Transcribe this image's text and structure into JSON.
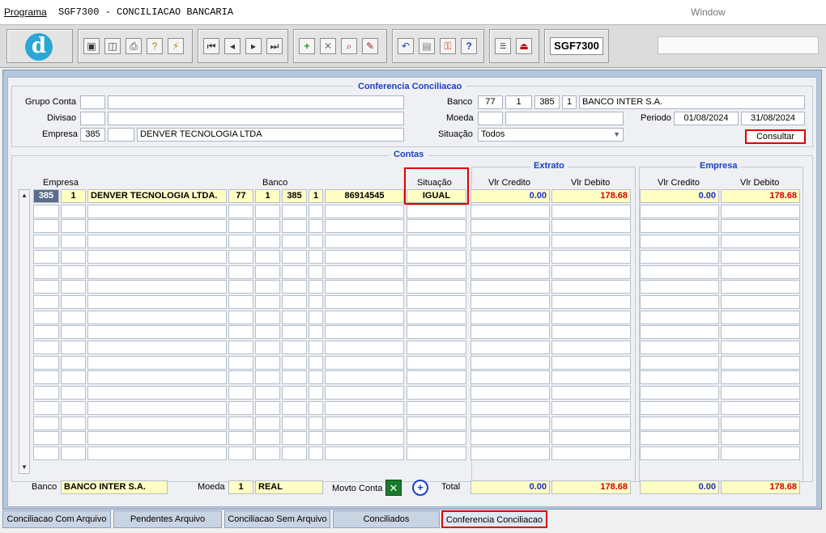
{
  "menubar": {
    "program": "Programa",
    "title": "SGF7300 - CONCILIACAO BANCARIA",
    "window": "Window"
  },
  "toolbar": {
    "code": "SGF7300",
    "icons": [
      "save-icon",
      "print-preview-icon",
      "printer-icon",
      "query-icon",
      "query-execute-icon",
      "first-record-icon",
      "previous-record-icon",
      "next-record-icon",
      "last-record-icon",
      "insert-record-icon",
      "delete-record-icon",
      "find-icon",
      "clear-icon",
      "undo-icon",
      "clipboard-icon",
      "key-help-icon",
      "help-icon",
      "menu-icon",
      "exit-icon"
    ]
  },
  "header": {
    "section_title": "Conferencia Conciliacao",
    "grupo_conta_label": "Grupo Conta",
    "grupo_conta_code": "",
    "grupo_conta_desc": "",
    "divisao_label": "Divisao",
    "divisao_code": "",
    "divisao_desc": "",
    "empresa_label": "Empresa",
    "empresa_code": "385",
    "empresa_sub": "",
    "empresa_desc": "DENVER TECNOLOGIA LTDA",
    "banco_label": "Banco",
    "banco_code": "77",
    "banco_agencia": "1",
    "banco_conta": "385",
    "banco_dig": "1",
    "banco_name": "BANCO INTER S.A.",
    "moeda_label": "Moeda",
    "moeda_code": "",
    "moeda_desc": "",
    "periodo_label": "Periodo",
    "periodo_start": "01/08/2024",
    "periodo_end": "31/08/2024",
    "situacao_label": "Situação",
    "situacao_value": "Todos",
    "consultar_label": "Consultar"
  },
  "grid": {
    "title": "Contas",
    "extrato_title": "Extrato",
    "empresa_title": "Empresa",
    "col_empresa": "Empresa",
    "col_banco": "Banco",
    "col_situacao": "Situação",
    "col_vlr_credito": "Vlr Credito",
    "col_vlr_debito": "Vlr Debito",
    "rows": [
      {
        "emp": "385",
        "sub": "1",
        "nome": "DENVER TECNOLOGIA LTDA.",
        "banco": "77",
        "ag": "1",
        "conta": "385",
        "dig": "1",
        "numero": "86914545",
        "situacao": "IGUAL",
        "ext_credito": "0.00",
        "ext_debito": "178.68",
        "emp_credito": "0.00",
        "emp_debito": "178.68"
      }
    ]
  },
  "footer": {
    "banco_label": "Banco",
    "banco_value": "BANCO INTER S.A.",
    "moeda_label": "Moeda",
    "moeda_code": "1",
    "moeda_desc": "REAL",
    "movto_label": "Movto Conta",
    "total_label": "Total",
    "ext_credito": "0.00",
    "ext_debito": "178.68",
    "emp_credito": "0.00",
    "emp_debito": "178.68"
  },
  "tabs": [
    {
      "label": "Conciliacao Com Arquivo"
    },
    {
      "label": "Pendentes Arquivo"
    },
    {
      "label": "Conciliacao Sem Arquivo"
    },
    {
      "label": "Conciliados"
    },
    {
      "label": "Conferencia Conciliacao",
      "active": true
    }
  ],
  "colors": {
    "accent_blue": "#1a3fc8",
    "highlight_yellow": "#ffffc4",
    "alert_red": "#e00000"
  }
}
